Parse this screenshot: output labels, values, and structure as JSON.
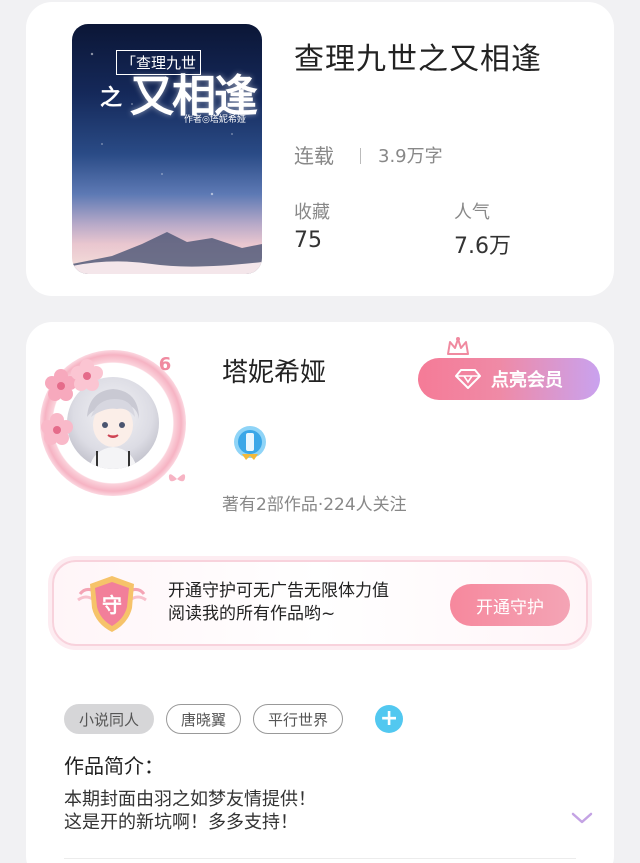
{
  "book": {
    "cover": {
      "title_small": "「查理九世",
      "title_zhi": "之",
      "title_big": "又相逢",
      "author_line": "作者◎塔妮希娅"
    },
    "title": "查理九世之又相逢",
    "status": "连载",
    "word_count": "3.9万字",
    "stats": {
      "favorites_label": "收藏",
      "favorites_value": "75",
      "popularity_label": "人气",
      "popularity_value": "7.6万"
    }
  },
  "author": {
    "level": "6",
    "name": "塔妮希娅",
    "vip_button_label": "点亮会员",
    "meta": "著有2部作品·224人关注",
    "badge_icon": "blue-medal-icon"
  },
  "guard": {
    "icon_char": "守",
    "text_line1": "开通守护可无广告无限体力值",
    "text_line2": "阅读我的所有作品哟~",
    "button_label": "开通守护"
  },
  "tags": [
    "小说同人",
    "唐晓翼",
    "平行世界"
  ],
  "add_tag_symbol": "+",
  "intro": {
    "heading": "作品简介：",
    "line1": "本期封面由羽之如梦友情提供！",
    "line2": "这是开的新坑啊！多多支持！"
  },
  "colors": {
    "accent_pink": "#f57b97",
    "accent_purple": "#c9a2ef",
    "tag_blue": "#52c8f0"
  }
}
